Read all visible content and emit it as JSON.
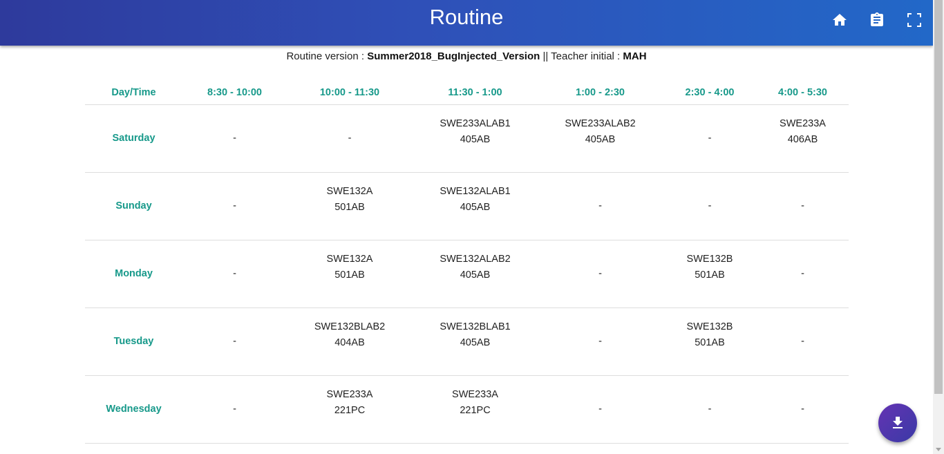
{
  "header": {
    "title": "Routine",
    "icons": [
      "home-icon",
      "clipboard-icon",
      "fullscreen-icon"
    ]
  },
  "info": {
    "version_label": "Routine version : ",
    "version_value": "Summer2018_BugInjected_Version",
    "separator": " || ",
    "teacher_label": "Teacher initial : ",
    "teacher_value": "MAH"
  },
  "table": {
    "columns": [
      "Day/Time",
      "8:30 - 10:00",
      "10:00 - 11:30",
      "11:30 - 1:00",
      "1:00 - 2:30",
      "2:30 - 4:00",
      "4:00 - 5:30"
    ],
    "rows": [
      {
        "day": "Saturday",
        "cells": [
          {
            "course": "-",
            "room": ""
          },
          {
            "course": "-",
            "room": ""
          },
          {
            "course": "SWE233ALAB1",
            "room": "405AB"
          },
          {
            "course": "SWE233ALAB2",
            "room": "405AB"
          },
          {
            "course": "-",
            "room": ""
          },
          {
            "course": "SWE233A",
            "room": "406AB"
          }
        ]
      },
      {
        "day": "Sunday",
        "cells": [
          {
            "course": "-",
            "room": ""
          },
          {
            "course": "SWE132A",
            "room": "501AB"
          },
          {
            "course": "SWE132ALAB1",
            "room": "405AB"
          },
          {
            "course": "-",
            "room": ""
          },
          {
            "course": "-",
            "room": ""
          },
          {
            "course": "-",
            "room": ""
          }
        ]
      },
      {
        "day": "Monday",
        "cells": [
          {
            "course": "-",
            "room": ""
          },
          {
            "course": "SWE132A",
            "room": "501AB"
          },
          {
            "course": "SWE132ALAB2",
            "room": "405AB"
          },
          {
            "course": "-",
            "room": ""
          },
          {
            "course": "SWE132B",
            "room": "501AB"
          },
          {
            "course": "-",
            "room": ""
          }
        ]
      },
      {
        "day": "Tuesday",
        "cells": [
          {
            "course": "-",
            "room": ""
          },
          {
            "course": "SWE132BLAB2",
            "room": "404AB"
          },
          {
            "course": "SWE132BLAB1",
            "room": "405AB"
          },
          {
            "course": "-",
            "room": ""
          },
          {
            "course": "SWE132B",
            "room": "501AB"
          },
          {
            "course": "-",
            "room": ""
          }
        ]
      },
      {
        "day": "Wednesday",
        "cells": [
          {
            "course": "-",
            "room": ""
          },
          {
            "course": "SWE233A",
            "room": "221PC"
          },
          {
            "course": "SWE233A",
            "room": "221PC"
          },
          {
            "course": "-",
            "room": ""
          },
          {
            "course": "-",
            "room": ""
          },
          {
            "course": "-",
            "room": ""
          }
        ]
      }
    ]
  },
  "fab": {
    "icon": "download-icon"
  }
}
